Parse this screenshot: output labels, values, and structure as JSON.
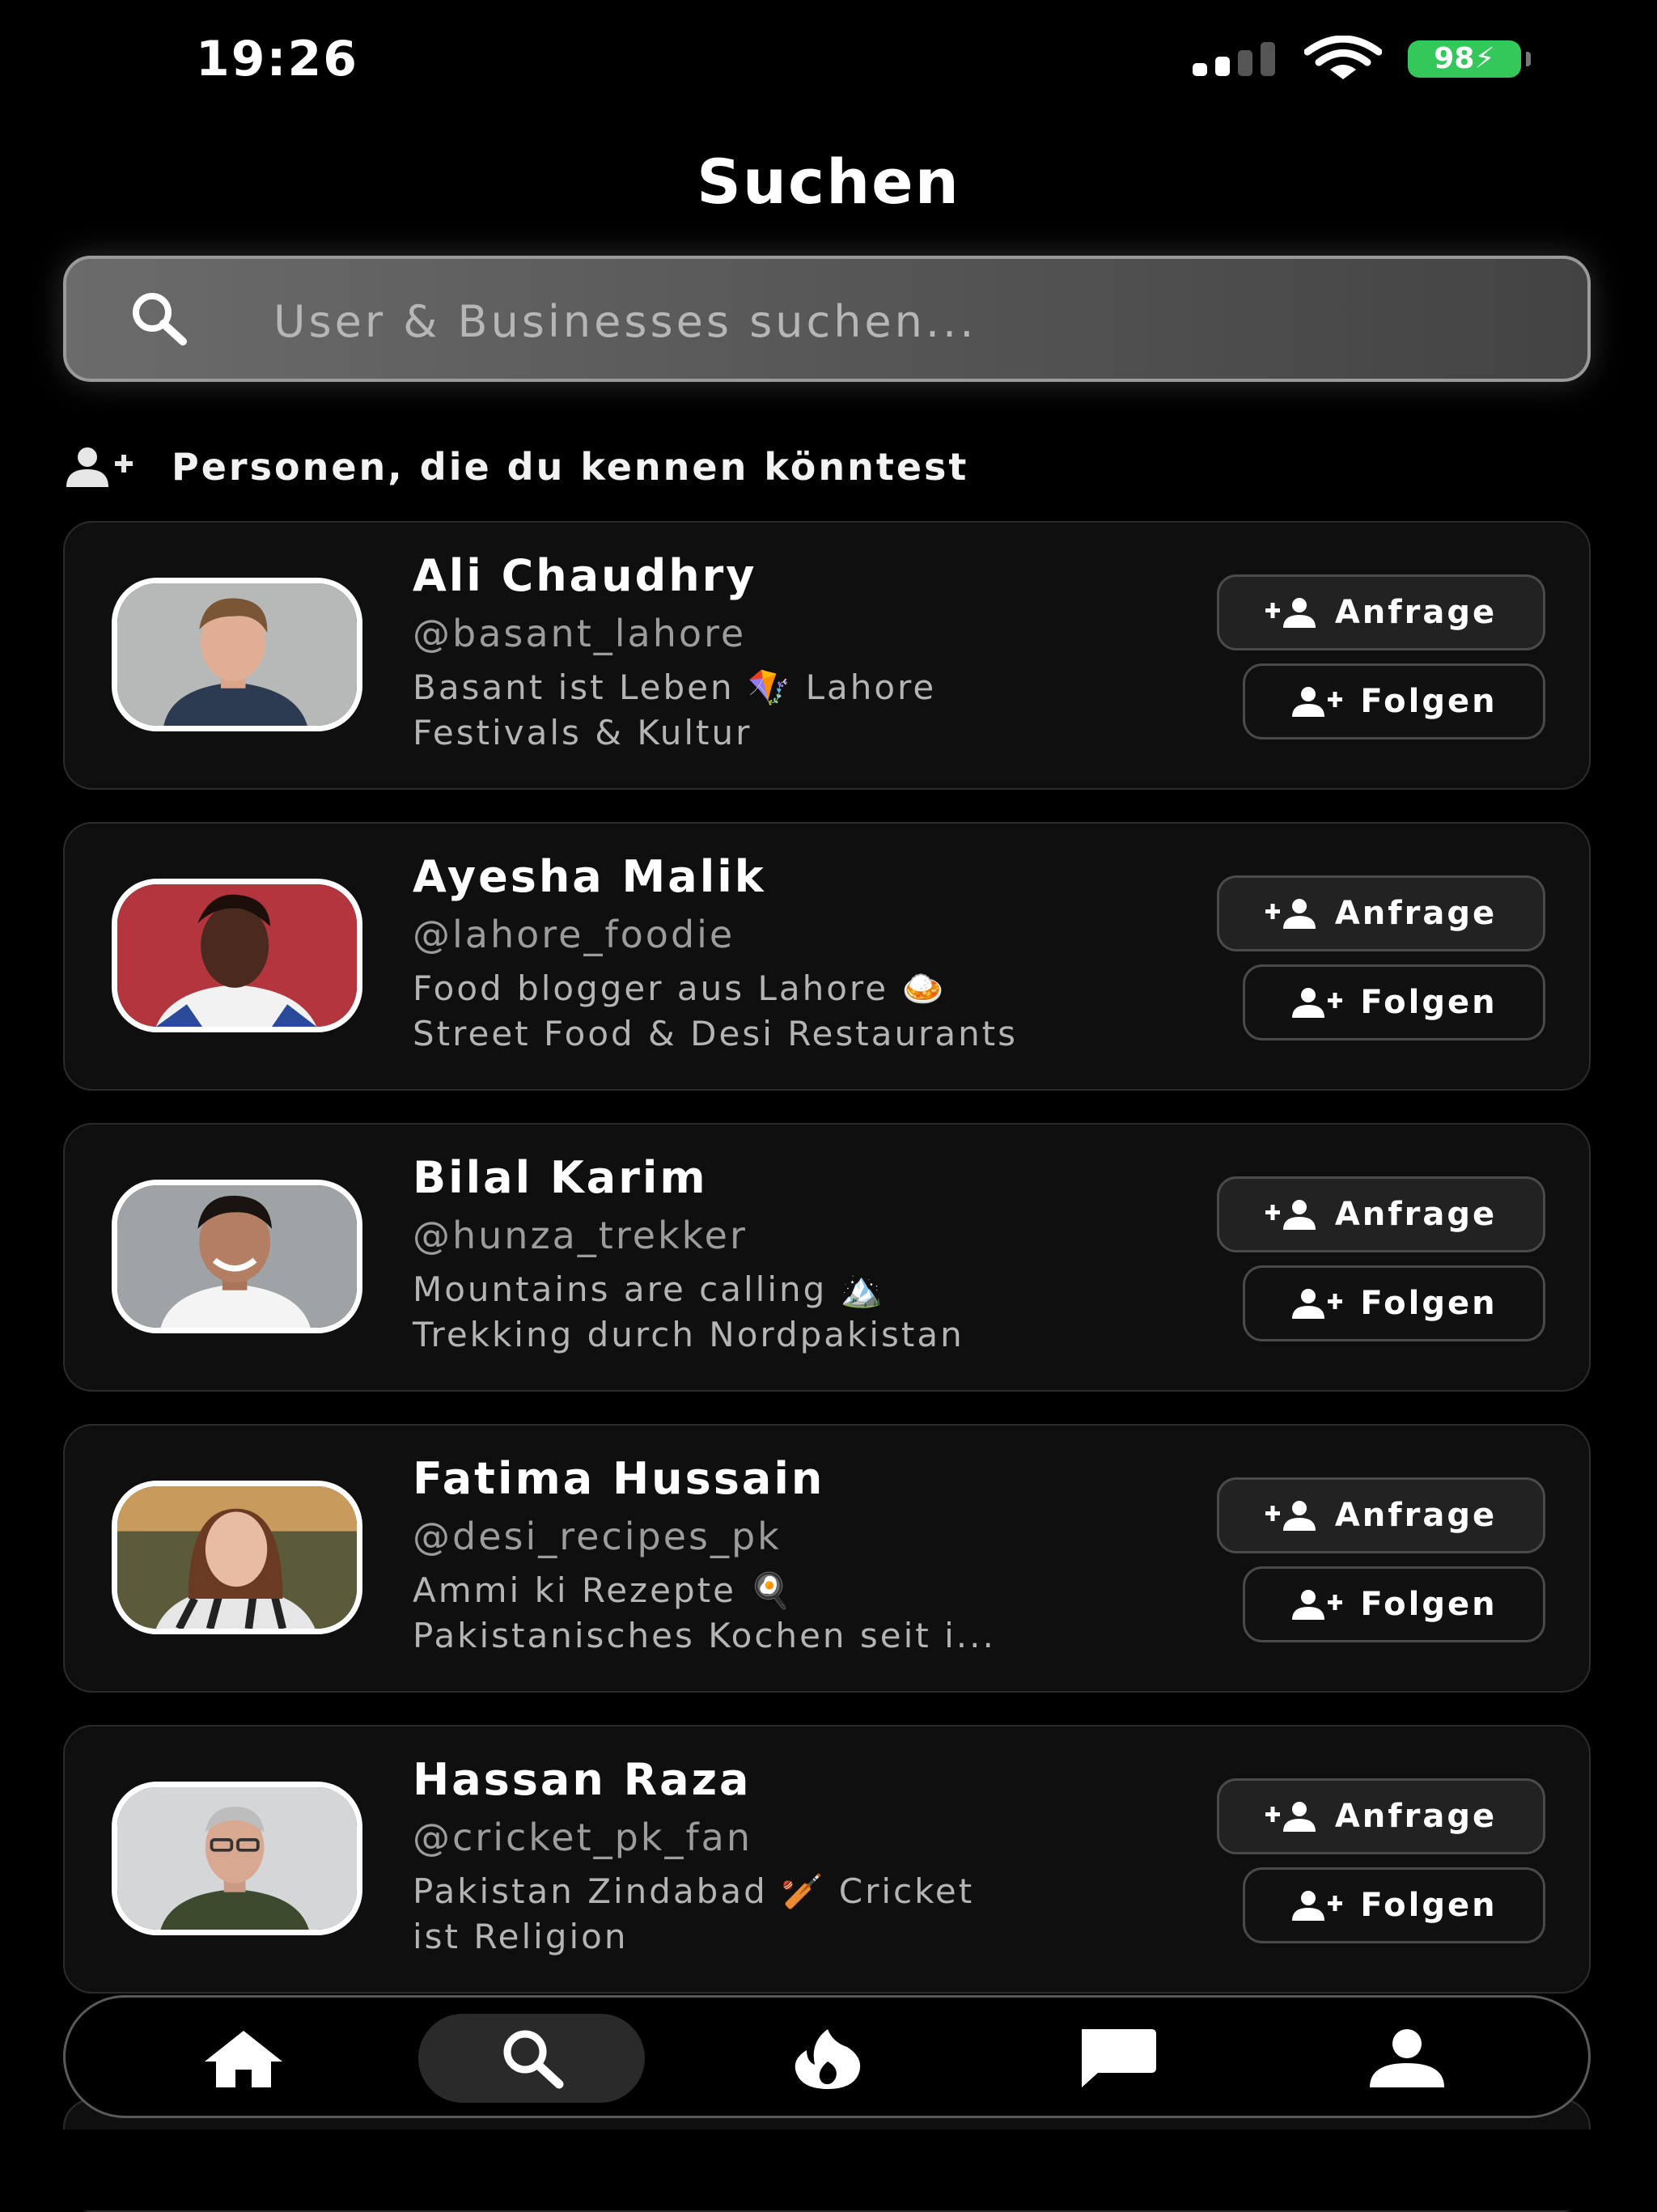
{
  "status_bar": {
    "time": "19:26",
    "battery": "98"
  },
  "page_title": "Suchen",
  "search": {
    "placeholder": "User & Businesses suchen..."
  },
  "section_title": "Personen, die du kennen könntest",
  "users": [
    {
      "name": "Ali Chaudhry",
      "handle": "@basant_lahore",
      "bio": "Basant ist Leben 🪁 Lahore\nFestivals & Kultur",
      "request_label": "Anfrage",
      "follow_label": "Folgen"
    },
    {
      "name": "Ayesha Malik",
      "handle": "@lahore_foodie",
      "bio": "Food blogger aus Lahore 🍛\nStreet Food & Desi Restaurants",
      "request_label": "Anfrage",
      "follow_label": "Folgen"
    },
    {
      "name": "Bilal Karim",
      "handle": "@hunza_trekker",
      "bio": "Mountains are calling 🏔️\nTrekking durch Nordpakistan",
      "request_label": "Anfrage",
      "follow_label": "Folgen"
    },
    {
      "name": "Fatima Hussain",
      "handle": "@desi_recipes_pk",
      "bio": "Ammi ki Rezepte 🍳\nPakistanisches Kochen seit i...",
      "request_label": "Anfrage",
      "follow_label": "Folgen"
    },
    {
      "name": "Hassan Raza",
      "handle": "@cricket_pk_fan",
      "bio": "Pakistan Zindabad 🏏 Cricket\nist Religion",
      "request_label": "Anfrage",
      "follow_label": "Folgen"
    }
  ],
  "tabs": [
    {
      "icon": "home-icon",
      "active": false
    },
    {
      "icon": "search-icon",
      "active": true
    },
    {
      "icon": "flame-icon",
      "active": false
    },
    {
      "icon": "chat-icon",
      "active": false
    },
    {
      "icon": "profile-icon",
      "active": false
    }
  ],
  "colors": {
    "background": "#000000",
    "card": "#0f0f0f",
    "battery": "#34c759",
    "handle": "#9c9c9c"
  }
}
